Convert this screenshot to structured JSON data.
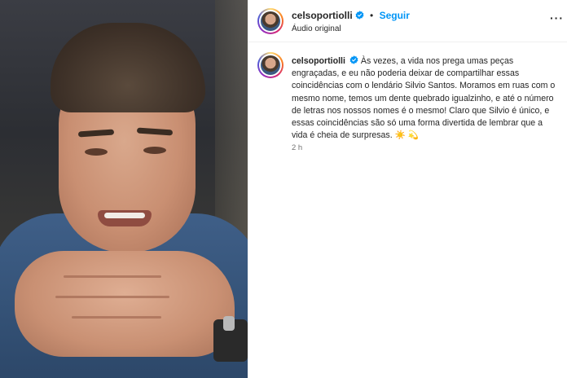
{
  "post": {
    "username": "celsoportiolli",
    "follow_label": "Seguir",
    "dot": "•",
    "audio_label": "Áudio original",
    "more_label": "···"
  },
  "caption": {
    "username": "celsoportiolli",
    "text": "Às vezes, a vida nos prega umas peças engraçadas, e eu não poderia deixar de compartilhar essas coincidências com o lendário Silvio Santos. Moramos em ruas com o mesmo nome, temos um dente quebrado igualzinho, e até o número de letras nos nossos nomes é o mesmo! Claro que Silvio é único, e essas coincidências são só uma forma divertida de lembrar que a vida é cheia de surpresas. ",
    "emoji_1": "☀️",
    "emoji_2": "💫",
    "timestamp": "2 h"
  },
  "icons": {
    "verified": "verified-badge-icon",
    "more": "more-options-icon"
  },
  "colors": {
    "follow": "#0095f6",
    "verified": "#0095f6",
    "muted": "#737373",
    "text": "#262626"
  }
}
